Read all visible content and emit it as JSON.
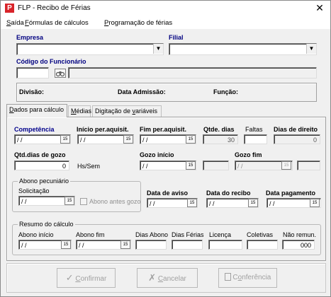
{
  "window": {
    "title": "FLP - Recibo de Férias",
    "icon": "P",
    "close": "✕"
  },
  "menu": [
    {
      "pre": "",
      "u": "S",
      "post": "aída"
    },
    {
      "pre": "",
      "u": "F",
      "post": "órmulas de cálculos"
    },
    {
      "pre": "",
      "u": "P",
      "post": "rogramação de férias"
    }
  ],
  "header": {
    "empresa_label": "Empresa",
    "filial_label": "Filial",
    "codigo_label": "Código do Funcionário",
    "divisao_label": "Divisão:",
    "admissao_label": "Data Admissão:",
    "funcao_label": "Função:"
  },
  "tabs": [
    {
      "pre": "",
      "u": "D",
      "post": "ados para cálculo"
    },
    {
      "pre": "",
      "u": "M",
      "post": "édias"
    },
    {
      "pre": "Digitação de ",
      "u": "v",
      "post": "ariáveis"
    }
  ],
  "calc": {
    "competencia_label": "Competência",
    "competencia_value": "/ /",
    "inicio_label": "Início per.aquisit.",
    "inicio_value": "/ /",
    "fim_label": "Fim per.aquisit.",
    "fim_value": "/ /",
    "qtde_label": "Qtde. dias",
    "qtde_value": "30",
    "faltas_label": "Faltas",
    "faltas_value": "",
    "direito_label": "Dias de direito",
    "direito_value": "0",
    "gozo_qtd_label": "Qtd.dias de gozo",
    "gozo_qtd_value": "0",
    "hs_sem_label": "Hs/Sem",
    "gozo_inicio_label": "Gozo início",
    "gozo_inicio_value": "/ /",
    "gozo_fim_label": "Gozo fim",
    "gozo_fim_value": "/ /"
  },
  "abono": {
    "group_title": "Abono pecuniário",
    "solicitacao_label": "Solicitação",
    "solicitacao_value": "/ /",
    "antes_gozo_label": "Abono antes gozo"
  },
  "datas": {
    "aviso_label": "Data de aviso",
    "aviso_value": "/ /",
    "recibo_label": "Data do recibo",
    "recibo_value": "/ /",
    "pagamento_label": "Data pagamento",
    "pagamento_value": "/ /"
  },
  "resumo": {
    "group_title": "Resumo do cálculo",
    "abono_inicio_label": "Abono início",
    "abono_inicio_value": "/ /",
    "abono_fim_label": "Abono fim",
    "abono_fim_value": "/ /",
    "dias_abono_label": "Dias Abono",
    "dias_ferias_label": "Dias Férias",
    "licenca_label": "Licença",
    "coletivas_label": "Coletivas",
    "nao_remun_label": "Não remun.",
    "nao_remun_value": "000"
  },
  "buttons": [
    {
      "pre": "",
      "u": "C",
      "post": "onfirmar"
    },
    {
      "pre": "",
      "u": "C",
      "post": "ancelar"
    },
    {
      "pre": "C",
      "u": "o",
      "post": "nferência"
    }
  ]
}
